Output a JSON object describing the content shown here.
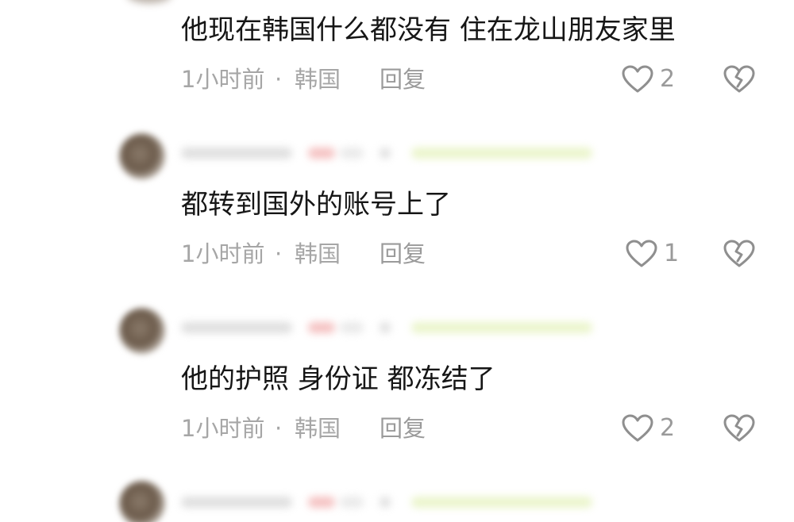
{
  "comments": [
    {
      "text": "他现在韩国什么都没有 住在龙山朋友家里",
      "time": "1小时前",
      "separator": "·",
      "location": "韩国",
      "reply_label": "回复",
      "like_count": "2"
    },
    {
      "text": "都转到国外的账号上了",
      "time": "1小时前",
      "separator": "·",
      "location": "韩国",
      "reply_label": "回复",
      "like_count": "1"
    },
    {
      "text": "他的护照 身份证 都冻结了",
      "time": "1小时前",
      "separator": "·",
      "location": "韩国",
      "reply_label": "回复",
      "like_count": "2"
    }
  ],
  "icons": {
    "like": "heart-outline-icon",
    "dislike": "broken-heart-icon"
  },
  "colors": {
    "text": "#161616",
    "meta": "#a6a6a6",
    "icon": "#8f8f8f"
  }
}
